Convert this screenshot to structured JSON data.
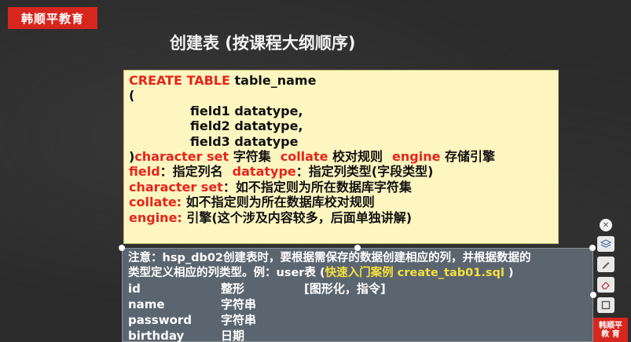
{
  "brand": {
    "label": "韩顺平教育"
  },
  "title": "创建表 (按课程大纲顺序)",
  "code": {
    "create": "CREATE TABLE",
    "table_name": " table_name",
    "open_paren": "(",
    "fields": [
      "field1  datatype,",
      "field2  datatype,",
      "field3  datatype"
    ],
    "close_paren": ")",
    "charset_kw": "character set",
    "charset_text": " 字符集",
    "collate_kw": "collate",
    "collate_text": " 校对规则",
    "engine_kw": "engine",
    "engine_text": " 存储引擎",
    "field_kw": "field",
    "field_text": "：指定列名",
    "datatype_kw": "datatype",
    "datatype_text": "：指定列类型(字段类型)",
    "charset2_kw": "character set",
    "charset2_text": "：如不指定则为所在数据库字符集",
    "collate2_kw": "collate:",
    "collate2_text": " 如不指定则为所在数据库校对规则",
    "engine2_kw": "engine:",
    "engine2_text": " 引擎(这个涉及内容较多，后面单独讲解)"
  },
  "note": {
    "line1": "注意：hsp_db02创建表时，要根据需保存的数据创建相应的列，并根据数据的",
    "line2_prefix": "类型定义相应的列类型。例：user表 (",
    "line2_link": "快速入门案例 create_tab01.sql",
    "line2_suffix": " )",
    "rows": [
      [
        "id",
        "整形",
        "[图形化，指令]"
      ],
      [
        "name",
        "字符串",
        ""
      ],
      [
        "password",
        "字符串",
        ""
      ],
      [
        "birthday",
        "日期",
        ""
      ]
    ]
  },
  "toolbar": {
    "icons": [
      "close-icon",
      "layers-icon",
      "pen-icon",
      "eraser-icon",
      "frame-icon"
    ]
  },
  "badge": {
    "line1": "韩顺平",
    "line2": "教 育"
  }
}
